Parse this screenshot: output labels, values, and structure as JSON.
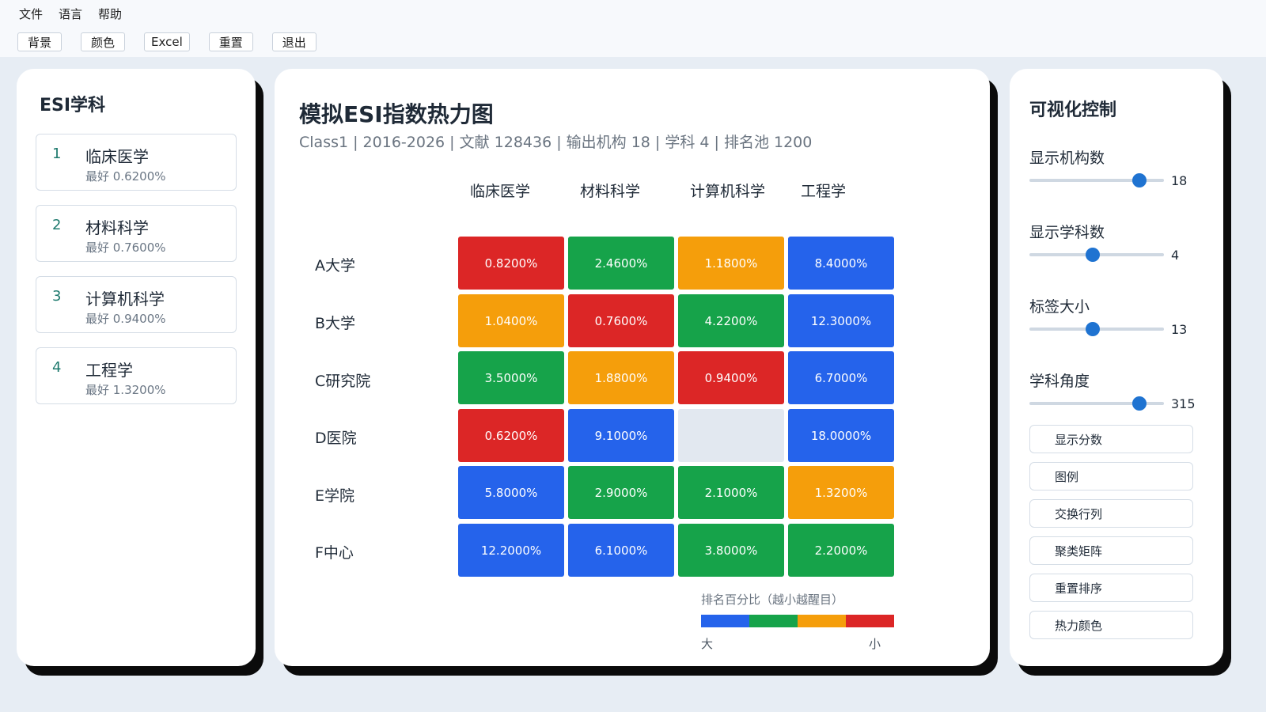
{
  "menubar": {
    "file": "文件",
    "language": "语言",
    "help": "帮助"
  },
  "toolbar": {
    "background": "背景",
    "color": "颜色",
    "excel": "Excel",
    "reset": "重置",
    "exit": "退出"
  },
  "left_panel": {
    "title": "ESI学科",
    "items": [
      {
        "num": "1",
        "name": "临床医学",
        "best": "最好 0.6200%"
      },
      {
        "num": "2",
        "name": "材料科学",
        "best": "最好 0.7600%"
      },
      {
        "num": "3",
        "name": "计算机科学",
        "best": "最好 0.9400%"
      },
      {
        "num": "4",
        "name": "工程学",
        "best": "最好 1.3200%"
      }
    ]
  },
  "center": {
    "title": "模拟ESI指数热力图",
    "subtitle": "Class1 | 2016-2026 | 文献 128436 | 输出机构 18 | 学科 4 | 排名池 1200",
    "columns": [
      "临床医学",
      "材料科学",
      "计算机科学",
      "工程学"
    ],
    "rows": [
      "A大学",
      "B大学",
      "C研究院",
      "D医院",
      "E学院",
      "F中心"
    ],
    "cells": [
      [
        {
          "text": "0.8200%",
          "color": "#dc2626"
        },
        {
          "text": "2.4600%",
          "color": "#16a34a"
        },
        {
          "text": "1.1800%",
          "color": "#f59e0b"
        },
        {
          "text": "8.4000%",
          "color": "#2563eb"
        }
      ],
      [
        {
          "text": "1.0400%",
          "color": "#f59e0b"
        },
        {
          "text": "0.7600%",
          "color": "#dc2626"
        },
        {
          "text": "4.2200%",
          "color": "#16a34a"
        },
        {
          "text": "12.3000%",
          "color": "#2563eb"
        }
      ],
      [
        {
          "text": "3.5000%",
          "color": "#16a34a"
        },
        {
          "text": "1.8800%",
          "color": "#f59e0b"
        },
        {
          "text": "0.9400%",
          "color": "#dc2626"
        },
        {
          "text": "6.7000%",
          "color": "#2563eb"
        }
      ],
      [
        {
          "text": "0.6200%",
          "color": "#dc2626"
        },
        {
          "text": "9.1000%",
          "color": "#2563eb"
        },
        {
          "text": "",
          "color": "#e2e8f0"
        },
        {
          "text": "18.0000%",
          "color": "#2563eb"
        }
      ],
      [
        {
          "text": "5.8000%",
          "color": "#2563eb"
        },
        {
          "text": "2.9000%",
          "color": "#16a34a"
        },
        {
          "text": "2.1000%",
          "color": "#16a34a"
        },
        {
          "text": "1.3200%",
          "color": "#f59e0b"
        }
      ],
      [
        {
          "text": "12.2000%",
          "color": "#2563eb"
        },
        {
          "text": "6.1000%",
          "color": "#2563eb"
        },
        {
          "text": "3.8000%",
          "color": "#16a34a"
        },
        {
          "text": "2.2000%",
          "color": "#16a34a"
        }
      ]
    ],
    "legend": {
      "label": "排名百分比（越小越醒目）",
      "colors": [
        "#2563eb",
        "#16a34a",
        "#f59e0b",
        "#dc2626"
      ],
      "big": "大",
      "small": "小"
    }
  },
  "right_panel": {
    "title": "可视化控制",
    "sliders": [
      {
        "label": "显示机构数",
        "value": "18",
        "fraction": 0.82
      },
      {
        "label": "显示学科数",
        "value": "4",
        "fraction": 0.47
      },
      {
        "label": "标签大小",
        "value": "13",
        "fraction": 0.47
      },
      {
        "label": "学科角度",
        "value": "315",
        "fraction": 0.82
      }
    ],
    "buttons": [
      "显示分数",
      "图例",
      "交换行列",
      "聚类矩阵",
      "重置排序",
      "热力颜色"
    ]
  }
}
